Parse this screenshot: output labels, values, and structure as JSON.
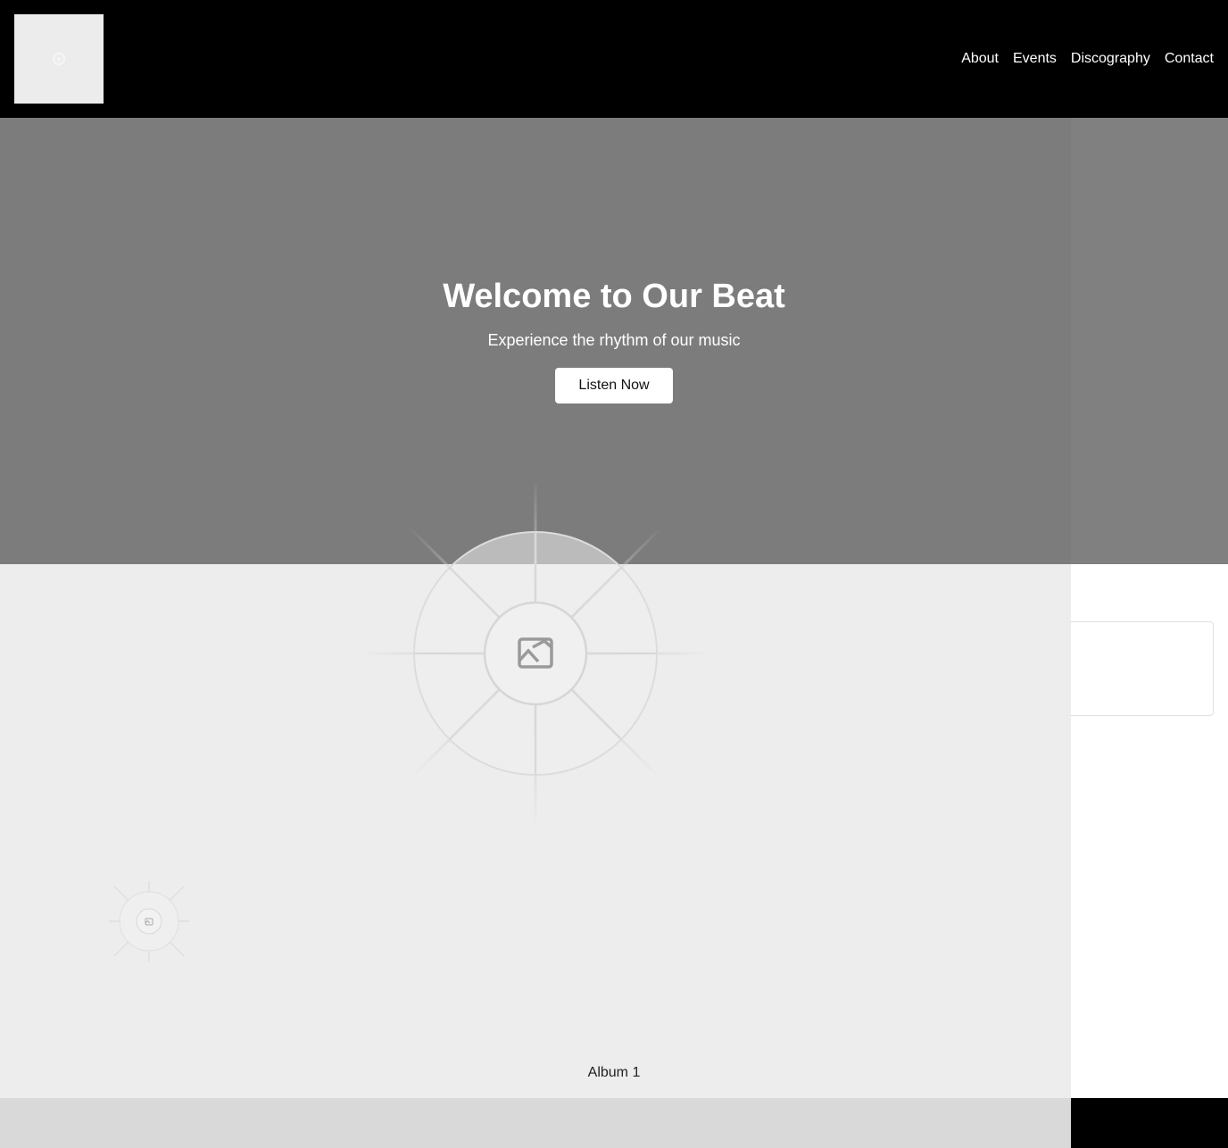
{
  "nav": {
    "items": [
      {
        "label": "About"
      },
      {
        "label": "Events"
      },
      {
        "label": "Discography"
      },
      {
        "label": "Contact"
      }
    ]
  },
  "hero": {
    "title": "Welcome to Our Beat",
    "subtitle": "Experience the rhythm of our music",
    "cta_label": "Listen Now"
  },
  "album": {
    "caption": "Album 1"
  },
  "colors": {
    "header_bg": "#000000",
    "hero_bg": "#808080",
    "panel_bg": "#ebebeb",
    "button_bg": "#ffffff"
  }
}
